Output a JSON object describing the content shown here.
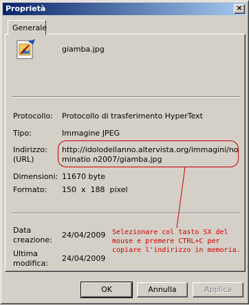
{
  "window": {
    "title": "Proprietà",
    "close_glyph": "×"
  },
  "tabs": [
    {
      "label": "Generale"
    }
  ],
  "file": {
    "name": "giamba.jpg",
    "icon": "jpeg-image-file-icon"
  },
  "fields": {
    "protocol": {
      "label": "Protocollo:",
      "value": "Protocollo di trasferimento HyperText"
    },
    "type": {
      "label": "Tipo:",
      "value": "Immagine JPEG"
    },
    "address": {
      "label": "Indirizzo:\n(URL)",
      "value": "http://idolodellanno.altervista.org/immagini/nominatio n2007/giamba.jpg"
    },
    "size": {
      "label": "Dimensioni:",
      "value": "11670 byte"
    },
    "format": {
      "label": "Formato:",
      "value": "150  x  188  pixel"
    },
    "created": {
      "label": "Data\ncreazione:",
      "value": "24/04/2009"
    },
    "modified": {
      "label": "Ultima\nmodifica:",
      "value": "24/04/2009"
    }
  },
  "annotation": {
    "text": "Selezionare col tasto SX del mouse e premere CTRL+C per copiare l'indirizzo in memoria.",
    "color": "#d00000"
  },
  "buttons": {
    "ok": "OK",
    "cancel": "Annulla",
    "apply": "Applica"
  },
  "colors": {
    "titlebar_start": "#0a246a",
    "titlebar_end": "#a6caf0",
    "face": "#d4d0c8"
  }
}
